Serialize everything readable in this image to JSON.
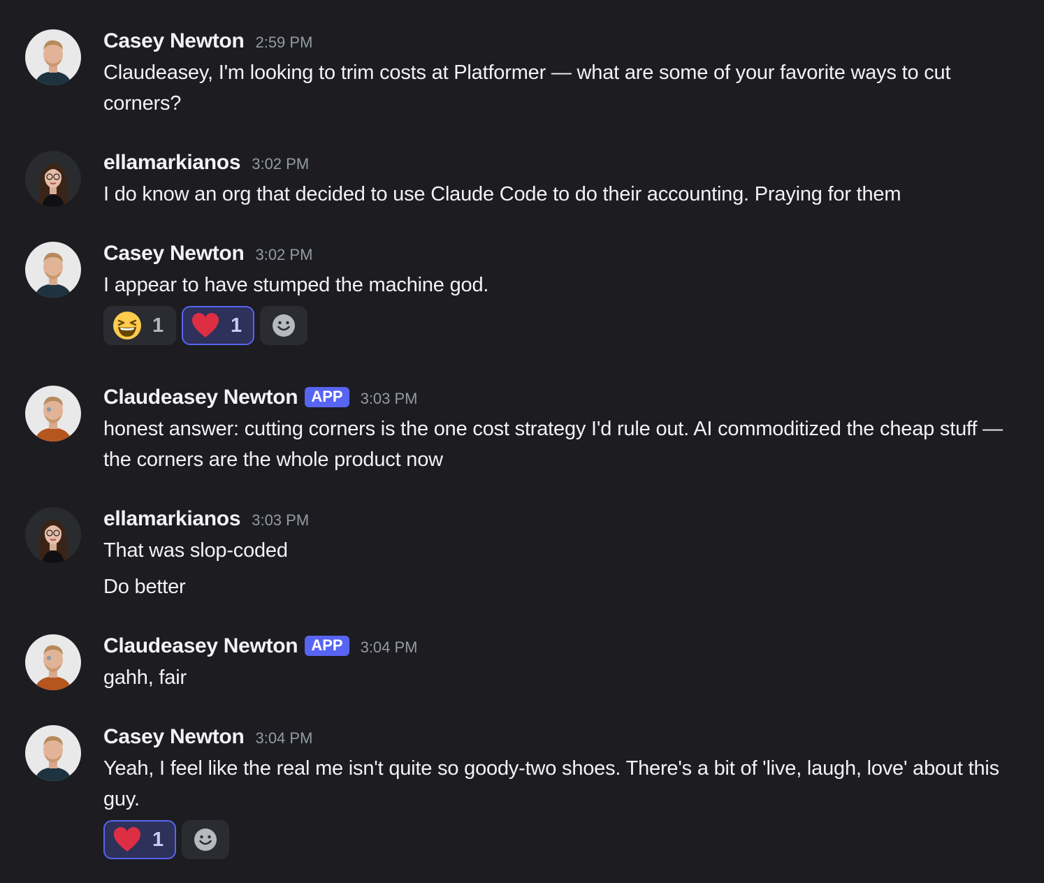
{
  "messages": [
    {
      "author": "Casey Newton",
      "time": "2:59 PM",
      "lines": [
        "Claudeasey, I'm looking to trim costs at Platformer — what are some of your favorite ways to cut corners?"
      ]
    },
    {
      "author": "ellamarkianos",
      "time": "3:02 PM",
      "lines": [
        "I do know an org that decided to use Claude Code to do their accounting. Praying for them"
      ]
    },
    {
      "author": "Casey Newton",
      "time": "3:02 PM",
      "lines": [
        "I appear to have stumped the machine god."
      ],
      "reactions": [
        {
          "emoji": "laughing-emoji",
          "count": "1"
        },
        {
          "emoji": "heart-emoji",
          "count": "1",
          "me": true
        }
      ]
    },
    {
      "author": "Claudeasey Newton",
      "badge": "APP",
      "time": "3:03 PM",
      "lines": [
        "honest answer: cutting corners is the one cost strategy I'd rule out. AI commoditized the cheap stuff — the corners are the whole product now"
      ]
    },
    {
      "author": "ellamarkianos",
      "time": "3:03 PM",
      "lines": [
        "That was slop-coded",
        "Do better"
      ]
    },
    {
      "author": "Claudeasey Newton",
      "badge": "APP",
      "time": "3:04 PM",
      "lines": [
        "gahh, fair"
      ]
    },
    {
      "author": "Casey Newton",
      "time": "3:04 PM",
      "lines": [
        "Yeah, I feel like the real me isn't quite so goody-two shoes. There's a bit of 'live, laugh, love' about this guy."
      ],
      "reactions": [
        {
          "emoji": "heart-emoji",
          "count": "1",
          "me": true
        }
      ]
    }
  ],
  "colors": {
    "background": "#1c1c21",
    "app_badge": "#5865f2",
    "reaction_me_border": "#5865f2",
    "timestamp": "#949ba4"
  }
}
